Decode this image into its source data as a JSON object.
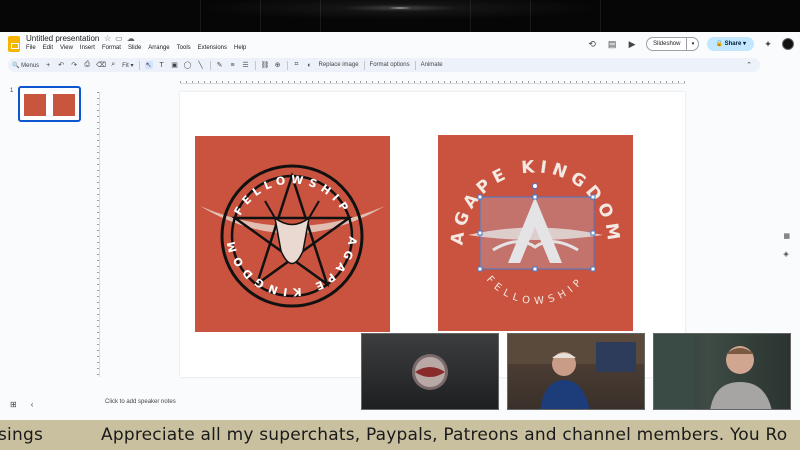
{
  "app": {
    "title": "Untitled presentation",
    "menus": [
      "File",
      "Edit",
      "View",
      "Insert",
      "Format",
      "Slide",
      "Arrange",
      "Tools",
      "Extensions",
      "Help"
    ]
  },
  "header": {
    "slideshow_label": "Slideshow",
    "share_label": "Share"
  },
  "toolbar": {
    "menus_label": "Menus",
    "zoom_label": "Fit",
    "replace_image_label": "Replace image",
    "format_options_label": "Format options",
    "animate_label": "Animate"
  },
  "filmstrip": {
    "slide_number": "1"
  },
  "slide": {
    "left_art": {
      "top_text": "FELLOWSHIP",
      "bottom_text": "AGAPE KINGDOM"
    },
    "right_art": {
      "top_text": "AGAPE KINGDOM",
      "bottom_text": "FELLOWSHIP"
    }
  },
  "notes": {
    "placeholder": "Click to add speaker notes"
  },
  "ticker": {
    "prefix": "sings",
    "text": "Appreciate all my superchats, Paypals, Patreons and channel members. You Ro"
  },
  "colors": {
    "art_bg": "#c9533f",
    "accent": "#0b57d0",
    "share_bg": "#c2e7ff",
    "ticker_bg": "#c9c09f"
  }
}
